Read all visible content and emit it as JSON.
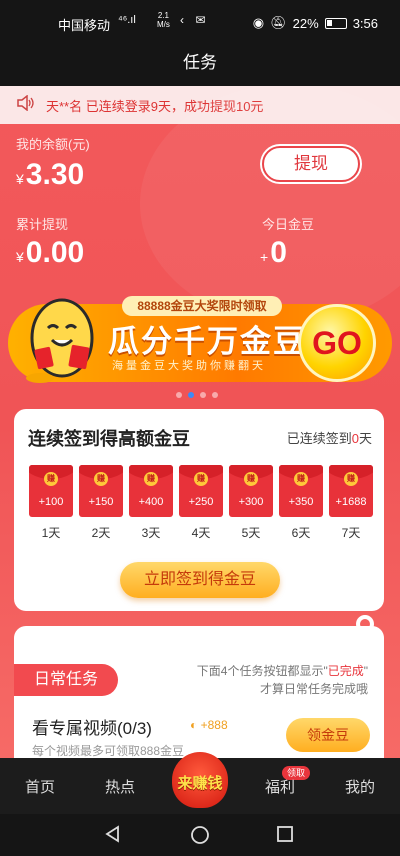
{
  "status": {
    "carrier": "中国移动",
    "signal": "⁴⁶.ıl",
    "speed_top": "2.1",
    "speed_bottom": "M/s",
    "battery": "22%",
    "time": "3:56"
  },
  "title": "任务",
  "marquee": "天**名 已连续登录9天，成功提现10元",
  "wallet": {
    "balance_label": "我的余额(元)",
    "currency_symbol": "¥",
    "balance": "3.30",
    "withdraw_button": "提现",
    "total_withdrawn_label": "累计提现",
    "total_withdrawn": "0.00",
    "today_beans_label": "今日金豆",
    "today_beans_prefix": "+",
    "today_beans": "0"
  },
  "banner": {
    "tag": "88888金豆大奖限时领取",
    "headline": "瓜分千万金豆",
    "subline": "海量金豆大奖助你赚翻天",
    "go": "GO",
    "active_slide": 2,
    "slide_count": 4
  },
  "checkin": {
    "title": "连续签到得高额金豆",
    "streak_prefix": "已连续签到",
    "streak_days": "0",
    "streak_suffix": "天",
    "seal": "赚",
    "days": [
      {
        "points": "+100",
        "day": "1天"
      },
      {
        "points": "+150",
        "day": "2天"
      },
      {
        "points": "+400",
        "day": "3天"
      },
      {
        "points": "+250",
        "day": "4天"
      },
      {
        "points": "+300",
        "day": "5天"
      },
      {
        "points": "+350",
        "day": "6天"
      },
      {
        "points": "+1688",
        "day": "7天"
      }
    ],
    "button": "立即签到得金豆"
  },
  "daily": {
    "tag": "日常任务",
    "note_line1_prefix": "下面4个任务按钮都显示\"",
    "note_line1_highlight": "已完成",
    "note_line1_suffix": "\"",
    "note_line2": "才算日常任务完成哦",
    "task_title": "看专属视频(0/3)",
    "task_reward": "+888",
    "task_desc": "每个视频最多可领取888金豆",
    "task_button": "领金豆"
  },
  "tabs": {
    "home": "首页",
    "hot": "热点",
    "earn": "来赚钱",
    "welfare": "福利",
    "welfare_badge": "领取",
    "mine": "我的"
  },
  "colors": {
    "accent_red": "#f05456",
    "gold": "#ffae20",
    "dark_bar": "#151515"
  }
}
